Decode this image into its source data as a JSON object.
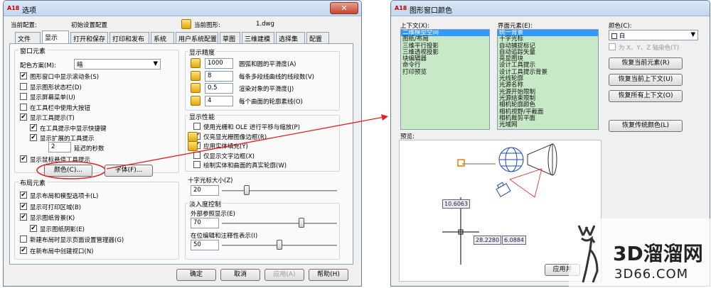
{
  "options_window": {
    "title": "选项",
    "profile_label": "当前配置:",
    "profile_value": "初始设置配置",
    "drawing_label": "当前图形:",
    "drawing_value": "1.dwg",
    "tabs": [
      "文件",
      "显示",
      "打开和保存",
      "打印和发布",
      "系统",
      "用户系统配置",
      "草图",
      "三维建模",
      "选择集",
      "配置"
    ],
    "active_tab": "显示",
    "window_elements": {
      "title": "窗口元素",
      "scheme_label": "配色方案(M):",
      "scheme_value": "暗",
      "checks": [
        {
          "label": "图形窗口中显示滚动条(S)",
          "checked": true
        },
        {
          "label": "显示图形状态栏(D)",
          "checked": false
        },
        {
          "label": "显示屏幕菜单(U)",
          "checked": false
        },
        {
          "label": "在工具栏中使用大按钮",
          "checked": false
        },
        {
          "label": "显示工具提示(T)",
          "checked": true
        },
        {
          "label": "在工具提示中显示快捷键",
          "checked": true
        },
        {
          "label": "显示扩展的工具提示",
          "checked": true
        }
      ],
      "delay_value": "2",
      "delay_label": "延迟的秒数",
      "rollover_label": "显示鼠标悬停工具提示",
      "rollover_checked": true,
      "colors_button": "颜色(C)...",
      "fonts_button": "字体(F)..."
    },
    "layout_elements": {
      "title": "布局元素",
      "checks": [
        {
          "label": "显示布局和模型选项卡(L)",
          "checked": true
        },
        {
          "label": "显示可打印区域(B)",
          "checked": true
        },
        {
          "label": "显示图纸背景(K)",
          "checked": true
        },
        {
          "label": "显示图纸阴影(E)",
          "checked": true
        },
        {
          "label": "新建布局时显示页面设置管理器(G)",
          "checked": false
        },
        {
          "label": "在新布局中创建视口(N)",
          "checked": true
        }
      ]
    },
    "resolution": {
      "title": "显示精度",
      "rows": [
        {
          "value": "1000",
          "label": "圆弧和圆的平滑度(A)"
        },
        {
          "value": "8",
          "label": "每条多段线曲线的线段数(V)"
        },
        {
          "value": "0.5",
          "label": "渲染对象的平滑度(J)"
        },
        {
          "value": "4",
          "label": "每个曲面的轮廓素线(O)"
        }
      ]
    },
    "performance": {
      "title": "显示性能",
      "checks": [
        {
          "label": "使用光栅和 OLE 进行平移与缩放(P)",
          "checked": false
        },
        {
          "label": "仅亮显光栅图像边框(R)",
          "checked": true
        },
        {
          "label": "应用实体填充(Y)",
          "checked": true
        },
        {
          "label": "仅显示文字边框(X)",
          "checked": false
        },
        {
          "label": "绘制实体和曲面的真实轮廓(W)",
          "checked": false
        }
      ]
    },
    "crosshair": {
      "title": "十字光标大小(Z)",
      "value": "20",
      "fraction": 0.2
    },
    "fade": {
      "title": "淡入度控制",
      "xref_label": "外部参照显示(E)",
      "xref_value": "70",
      "xref_fraction": 0.7,
      "inplace_label": "在位编辑和注释性表示(I)",
      "inplace_value": "50",
      "inplace_fraction": 0.5
    },
    "buttons": [
      "确定",
      "取消",
      "应用(A)",
      "帮助(H)"
    ]
  },
  "color_window": {
    "title": "图形窗口颜色",
    "context_label": "上下文(X):",
    "contexts": [
      "二维模型空间",
      "图纸/布局",
      "三维平行投影",
      "三维透视投影",
      "块编辑器",
      "命令行",
      "打印预览"
    ],
    "element_label": "界面元素(E):",
    "elements": [
      "统一背景",
      "十字光标",
      "自动捕捉标记",
      "自动追踪矢量",
      "亮显图块",
      "设计工具提示",
      "设计工具提示背景",
      "光线轮廓",
      "光源名称",
      "光源开始限制",
      "光源结束限制",
      "相机轮廓颜色",
      "相机视野/平截面",
      "相机裁剪平面",
      "光域网"
    ],
    "color_label": "颜色(C):",
    "color_value": "白",
    "tint_label": "为 X、Y、Z 轴染色(T)",
    "actions": [
      "恢复当前元素(R)",
      "恢复当前上下文(U)",
      "恢复所有上下文(O)",
      "恢复传统颜色(L)"
    ],
    "preview_label": "预览:",
    "coords": [
      "10.6063",
      "28.2280",
      "6.0884"
    ],
    "apply_button": "应用并"
  },
  "watermark": {
    "brand": "3D溜溜网",
    "site": "3D66.COM"
  },
  "colors": {
    "accent": "#e02020",
    "list_bg": "#c7e9c7",
    "selection": "#3399ff"
  }
}
